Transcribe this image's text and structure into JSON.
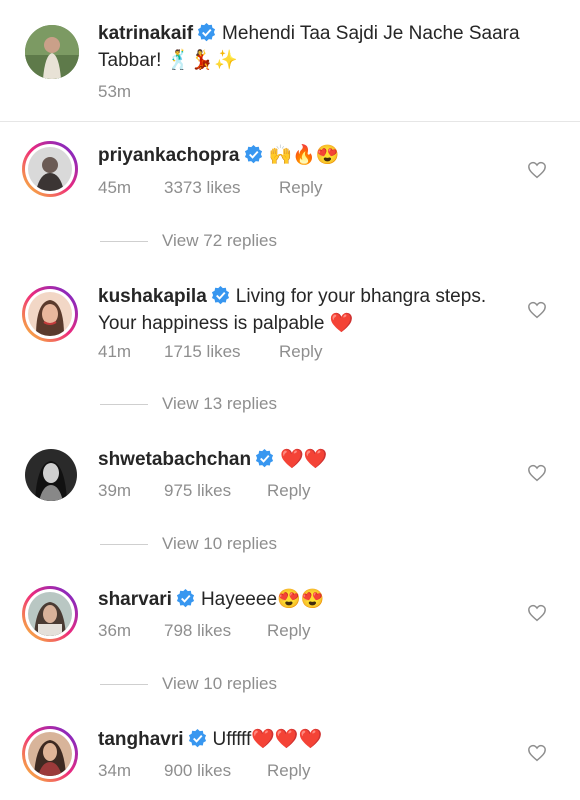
{
  "caption": {
    "username": "katrinakaif",
    "text": "Mehendi Taa Sajdi Je Nache Saara Tabbar! 🕺💃✨",
    "time": "53m"
  },
  "comments": [
    {
      "username": "priyankachopra",
      "text": "🙌🔥😍",
      "time": "45m",
      "likes": "3373 likes",
      "reply": "Reply",
      "view_replies": "View 72 replies"
    },
    {
      "username": "kushakapila",
      "text": "Living for your bhangra steps. Your happiness is palpable ❤️",
      "time": "41m",
      "likes": "1715 likes",
      "reply": "Reply",
      "view_replies": "View 13 replies"
    },
    {
      "username": "shwetabachchan",
      "text": "❤️❤️",
      "time": "39m",
      "likes": "975 likes",
      "reply": "Reply",
      "view_replies": "View 10 replies"
    },
    {
      "username": "sharvari",
      "text": "Hayeeee😍😍",
      "time": "36m",
      "likes": "798 likes",
      "reply": "Reply",
      "view_replies": "View 10 replies"
    },
    {
      "username": "tanghavri",
      "text": "Ufffff❤️❤️❤️",
      "time": "34m",
      "likes": "900 likes",
      "reply": "Reply"
    }
  ],
  "icons": {
    "verified": "verified-badge-icon",
    "like": "heart-outline-icon"
  },
  "colors": {
    "verified": "#3897f0",
    "muted": "#8e8e8e",
    "text": "#262626"
  }
}
